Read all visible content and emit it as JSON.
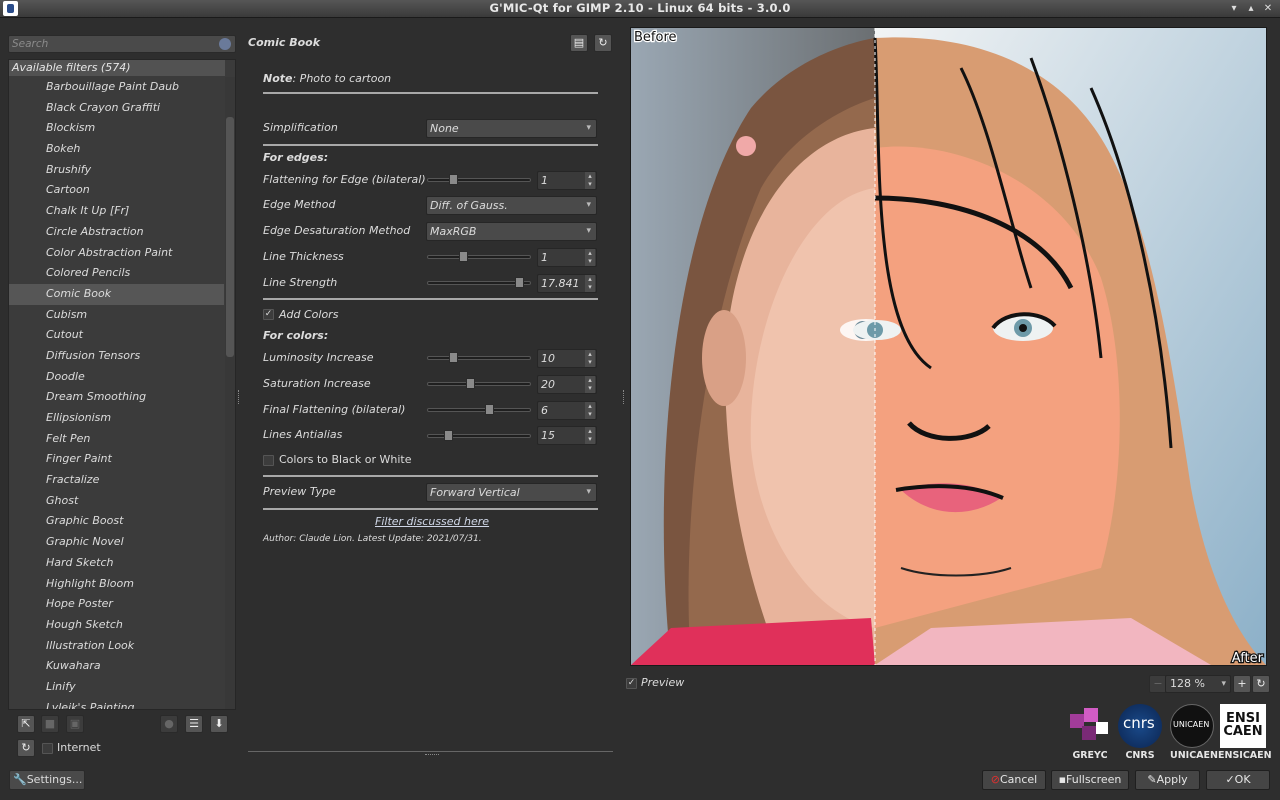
{
  "window": {
    "title": "G'MIC-Qt for GIMP 2.10 - Linux 64 bits - 3.0.0"
  },
  "search": {
    "placeholder": "Search"
  },
  "filters": {
    "header": "Available filters (574)",
    "items": [
      "Barbouillage Paint Daub",
      "Black Crayon Graffiti",
      "Blockism",
      "Bokeh",
      "Brushify",
      "Cartoon",
      "Chalk It Up [Fr]",
      "Circle Abstraction",
      "Color Abstraction Paint",
      "Colored Pencils",
      "Comic Book",
      "Cubism",
      "Cutout",
      "Diffusion Tensors",
      "Doodle",
      "Dream Smoothing",
      "Ellipsionism",
      "Felt Pen",
      "Finger Paint",
      "Fractalize",
      "Ghost",
      "Graphic Boost",
      "Graphic Novel",
      "Hard Sketch",
      "Highlight Bloom",
      "Hope Poster",
      "Hough Sketch",
      "Illustration Look",
      "Kuwahara",
      "Linify",
      "Lylejk's Painting"
    ],
    "selected": "Comic Book"
  },
  "left_bottom": {
    "internet_label": "Internet",
    "settings_label": "Settings..."
  },
  "params": {
    "filter_title": "Comic Book",
    "note_bold": "Note",
    "note_text": ": Photo to cartoon",
    "simplification_label": "Simplification",
    "simplification_value": "None",
    "for_edges": "For edges:",
    "flattening_label": "Flattening for Edge (bilateral)",
    "flattening_value": "1",
    "edge_method_label": "Edge Method",
    "edge_method_value": "Diff. of Gauss.",
    "edge_desat_label": "Edge Desaturation Method",
    "edge_desat_value": "MaxRGB",
    "line_thickness_label": "Line Thickness",
    "line_thickness_value": "1",
    "line_strength_label": "Line Strength",
    "line_strength_value": "17.841",
    "add_colors_label": "Add Colors",
    "for_colors": "For colors:",
    "luminosity_label": "Luminosity Increase",
    "luminosity_value": "10",
    "saturation_label": "Saturation Increase",
    "saturation_value": "20",
    "final_flat_label": "Final Flattening (bilateral)",
    "final_flat_value": "6",
    "antialias_label": "Lines Antialias",
    "antialias_value": "15",
    "bw_label": "Colors to Black or White",
    "preview_type_label": "Preview Type",
    "preview_type_value": "Forward Vertical",
    "link": "Filter discussed here",
    "author": "Author: Claude Lion. Latest Update: 2021/07/31."
  },
  "slider_fractions": {
    "flattening": 0.22,
    "line_thickness": 0.33,
    "line_strength": 0.92,
    "luminosity": 0.22,
    "saturation": 0.4,
    "final_flat": 0.6,
    "antialias": 0.17
  },
  "preview": {
    "before_label": "Before",
    "after_label": "After",
    "checkbox_label": "Preview",
    "zoom": "128 %"
  },
  "logos": [
    "GREYC",
    "CNRS",
    "UNICAEN",
    "ENSICAEN"
  ],
  "logo_text": {
    "cnrs": "cnrs",
    "unicaen": "UNICAEN",
    "ensi_1": "ENSI",
    "ensi_2": "CAEN"
  },
  "buttons": {
    "cancel": "Cancel",
    "fullscreen": "Fullscreen",
    "apply": "Apply",
    "ok": "OK"
  }
}
